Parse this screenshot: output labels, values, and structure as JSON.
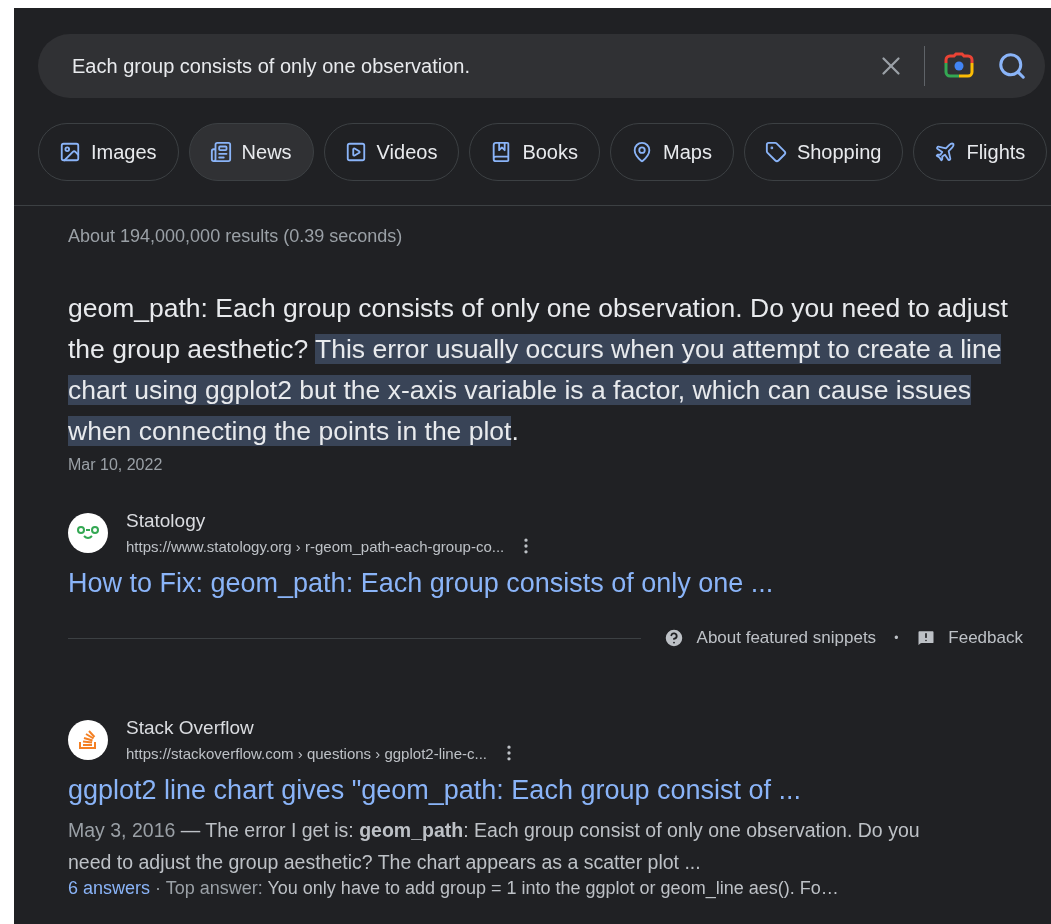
{
  "search": {
    "value": "Each group consists of only one observation."
  },
  "chips": [
    {
      "label": "Images",
      "selected": false
    },
    {
      "label": "News",
      "selected": true
    },
    {
      "label": "Videos",
      "selected": false
    },
    {
      "label": "Books",
      "selected": false
    },
    {
      "label": "Maps",
      "selected": false
    },
    {
      "label": "Shopping",
      "selected": false
    },
    {
      "label": "Flights",
      "selected": false
    }
  ],
  "result_stats": "About 194,000,000 results (0.39 seconds)",
  "featured_snippet": {
    "parts": [
      {
        "text": "geom_path: Each group consists of only one observation. Do you need to adjust the group aesthetic? ",
        "highlighted": false
      },
      {
        "text": "This error usually occurs when you attempt to create a line chart using ggplot2 but the x-axis variable is a factor, which can cause issues when connecting the points in the plot",
        "highlighted": true
      },
      {
        "text": ".",
        "highlighted": false
      }
    ],
    "date": "Mar 10, 2022",
    "source": {
      "site": "Statology",
      "url": "https://www.statology.org › r-geom_path-each-group-co..."
    },
    "title": "How to Fix: geom_path: Each group consists of only one ...",
    "footer": {
      "about": "About featured snippets",
      "separator": "•",
      "feedback": "Feedback"
    }
  },
  "results": [
    {
      "site": "Stack Overflow",
      "url": "https://stackoverflow.com › questions › ggplot2-line-c...",
      "title": "ggplot2 line chart gives \"geom_path: Each group consist of ...",
      "date": "May 3, 2016",
      "snippet": "— The error I get is: **geom_path**: Each group consist of only one observation. Do you need to adjust the group aesthetic? The chart appears as a scatter plot ...",
      "answers_link": "6 answers",
      "answer_label": "· Top answer:",
      "answer_text": "You only have to add group = 1 into the ggplot or geom_line aes(). Fo…"
    }
  ]
}
